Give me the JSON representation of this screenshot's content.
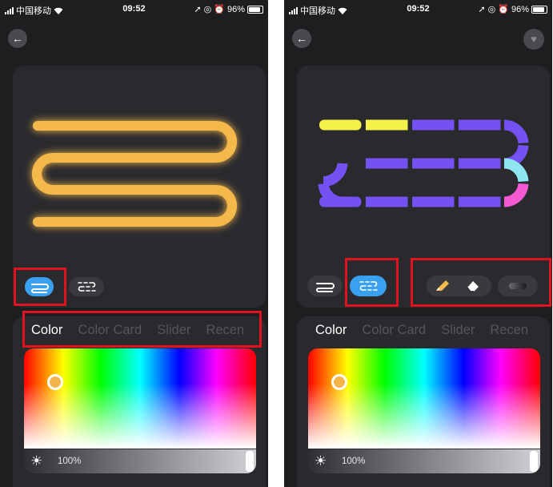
{
  "left": {
    "status": {
      "carrier": "中国移动",
      "time": "09:52",
      "battery": "96%"
    },
    "tabs": [
      "Color",
      "Color Card",
      "Slider",
      "Recen"
    ],
    "active_tab": 0,
    "brightness": "100%",
    "brightness_level": 1.0,
    "active_mode": "line",
    "strip_color": "#f5b84b",
    "selected_color": "#f4b44c"
  },
  "right": {
    "status": {
      "carrier": "中国移动",
      "time": "09:52",
      "battery": "96%"
    },
    "tabs": [
      "Color",
      "Color Card",
      "Slider",
      "Recen"
    ],
    "active_tab": 0,
    "brightness": "100%",
    "brightness_level": 1.0,
    "active_mode": "segment",
    "tools": [
      "pencil-icon",
      "eraser-icon",
      "gradient-icon"
    ],
    "segment_colors": [
      "#f5f04a",
      "#f5f04a",
      "#7452f2",
      "#7452f2",
      "#7452f2",
      "#7452f2",
      "#7452f2",
      "#7452f2",
      "#7452f2",
      "#7452f2",
      "#7452f2",
      "#7452f2",
      "#7452f2",
      "#7452f2",
      "#7452f2",
      "#8ee6f2",
      "#f55ad2",
      "#7452f2",
      "#7452f2",
      "#7452f2"
    ],
    "selected_color": "#f4b44c"
  },
  "highlight_color": "#e0141e"
}
